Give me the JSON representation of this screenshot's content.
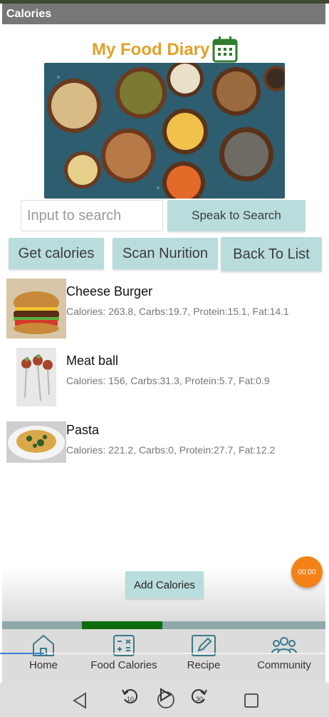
{
  "app": {
    "title": "Calories"
  },
  "header": {
    "title": "My Food Diary",
    "icon": "calendar-icon"
  },
  "hero": {
    "icon": "food-bowls-image"
  },
  "search": {
    "placeholder": "Input to search",
    "value": ""
  },
  "buttons": {
    "speak": "Speak to Search",
    "get_calories": "Get calories",
    "scan": "Scan Nurition",
    "back": "Back To List",
    "add": "Add Calories"
  },
  "food_items": [
    {
      "name": "Cheese Burger",
      "info": "Calories: 263.8, Carbs:19.7, Protein:15.1, Fat:14.1"
    },
    {
      "name": "Meat ball",
      "info": "Calories: 156, Carbs:31.3, Protein:5.7, Fat:0.9"
    },
    {
      "name": "Pasta",
      "info": "Calories: 221.2, Carbs:0, Protein:27.7, Fat:12.2"
    }
  ],
  "timer": {
    "label": "00:00",
    "color": "#f58216"
  },
  "nav": {
    "items": [
      {
        "label": "Home",
        "icon": "home-icon"
      },
      {
        "label": "Food Calories",
        "icon": "calculator-icon"
      },
      {
        "label": "Recipe",
        "icon": "edit-note-icon"
      },
      {
        "label": "Community",
        "icon": "people-icon"
      }
    ],
    "active_index": 1
  },
  "media": {
    "rewind": "10",
    "forward": "30"
  },
  "colors": {
    "accent": "#e0a12a",
    "button": "#b9dcdc",
    "active_tab": "#0e6b0e",
    "nav_icon": "#3a7a8a"
  }
}
